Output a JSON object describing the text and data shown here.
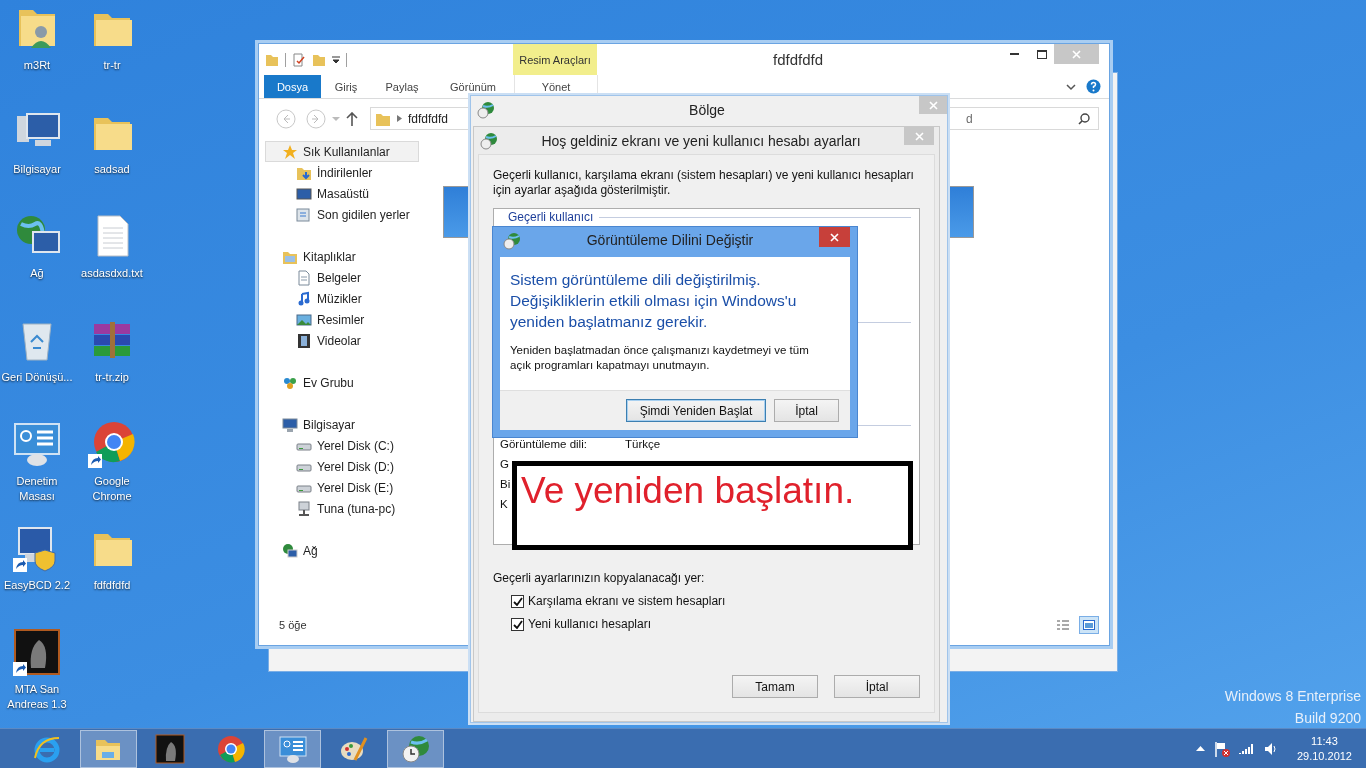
{
  "desktop_icons": [
    {
      "label": "m3Rt",
      "kind": "user-folder",
      "shortcut": false
    },
    {
      "label": "tr-tr",
      "kind": "folder",
      "shortcut": false
    },
    {
      "label": "Bilgisayar",
      "kind": "computer",
      "shortcut": false
    },
    {
      "label": "sadsad",
      "kind": "folder",
      "shortcut": false
    },
    {
      "label": "Ağ",
      "kind": "network",
      "shortcut": false
    },
    {
      "label": "asdasdxd.txt",
      "kind": "text",
      "shortcut": false
    },
    {
      "label": "Geri Dönüşü...",
      "kind": "recycle",
      "shortcut": false
    },
    {
      "label": "tr-tr.zip",
      "kind": "archive",
      "shortcut": false
    },
    {
      "label": "Denetim Masası",
      "kind": "control-panel",
      "shortcut": false
    },
    {
      "label": "Google Chrome",
      "kind": "chrome",
      "shortcut": true
    },
    {
      "label": "EasyBCD 2.2",
      "kind": "installer",
      "shortcut": true
    },
    {
      "label": "fdfdfdfd",
      "kind": "folder",
      "shortcut": false
    },
    {
      "label": "MTA San Andreas 1.3",
      "kind": "game",
      "shortcut": true
    }
  ],
  "watermark": [
    "Windows 8 Enterprise",
    "Build 9200"
  ],
  "explorer": {
    "contextual_tab": "Resim Araçları",
    "title": "fdfdfdfd",
    "ribbon_tabs": [
      {
        "label": "Dosya",
        "selected": true
      },
      {
        "label": "Giriş",
        "selected": false
      },
      {
        "label": "Paylaş",
        "selected": false
      },
      {
        "label": "Görünüm",
        "selected": false
      },
      {
        "label": "Yönet",
        "selected": false
      }
    ],
    "address": "fdfdfdfd",
    "search_placeholder": "d",
    "nav": [
      {
        "label": "Sık Kullanılanlar",
        "kind": "star",
        "selected": true,
        "children": [
          {
            "label": "İndirilenler",
            "kind": "download",
            "selected": false
          },
          {
            "label": "Masaüstü",
            "kind": "desktop",
            "selected": false
          },
          {
            "label": "Son gidilen yerler",
            "kind": "recent",
            "selected": false
          }
        ]
      },
      {
        "label": "Kitaplıklar",
        "kind": "library",
        "selected": false,
        "children": [
          {
            "label": "Belgeler",
            "kind": "documents",
            "selected": false
          },
          {
            "label": "Müzikler",
            "kind": "music",
            "selected": false
          },
          {
            "label": "Resimler",
            "kind": "pictures",
            "selected": false
          },
          {
            "label": "Videolar",
            "kind": "videos",
            "selected": false
          }
        ]
      },
      {
        "label": "Ev Grubu",
        "kind": "homegroup",
        "selected": false
      },
      {
        "label": "Bilgisayar",
        "kind": "computer",
        "selected": false,
        "children": [
          {
            "label": "Yerel Disk (C:)",
            "kind": "disk",
            "selected": false
          },
          {
            "label": "Yerel Disk (D:)",
            "kind": "disk",
            "selected": false
          },
          {
            "label": "Yerel Disk (E:)",
            "kind": "disk",
            "selected": false
          },
          {
            "label": "Tuna (tuna-pc)",
            "kind": "network-drive",
            "selected": false
          }
        ]
      },
      {
        "label": "Ağ",
        "kind": "network",
        "selected": false
      }
    ],
    "status": "5 öğe"
  },
  "region_dialog": {
    "title": "Bölge"
  },
  "welcome_dialog": {
    "title": "Hoş geldiniz ekranı ve yeni kullanıcı hesabı ayarları",
    "intro": "Geçerli kullanıcı, karşılama ekranı (sistem hesapları) ve yeni kullanıcı hesapları için ayarlar aşağıda gösterilmiştir.",
    "group_label": "Geçerli kullanıcı",
    "rows": [
      {
        "label": "Görüntüleme dili:",
        "value": "Türkçe"
      },
      {
        "label": "G"
      },
      {
        "label": "Bi"
      },
      {
        "label": "K"
      }
    ],
    "copy_label": "Geçerli ayarlarınızın kopyalanacağı yer:",
    "checkboxes": [
      {
        "label": "Karşılama ekranı ve sistem hesapları",
        "checked": true
      },
      {
        "label": "Yeni kullanıcı hesapları",
        "checked": true
      }
    ],
    "buttons": [
      "Tamam",
      "İptal"
    ]
  },
  "change_dialog": {
    "title": "Görüntüleme Dilini Değiştir",
    "headline": "Sistem görüntüleme dili değiştirilmiş. Değişikliklerin etkili olması için Windows'u yeniden başlatmanız gerekir.",
    "body": "Yeniden başlatmadan önce çalışmanızı kaydetmeyi ve tüm açık programları kapatmayı unutmayın.",
    "buttons": [
      {
        "label": "Şimdi Yeniden Başlat",
        "default": true
      },
      {
        "label": "İptal",
        "default": false
      }
    ]
  },
  "annotation": "Ve yeniden başlatın.",
  "taskbar": {
    "apps": [
      {
        "kind": "ie",
        "active": false
      },
      {
        "kind": "explorer",
        "active": true
      },
      {
        "kind": "game",
        "active": false
      },
      {
        "kind": "chrome",
        "active": false
      },
      {
        "kind": "control-panel",
        "active": true
      },
      {
        "kind": "paint",
        "active": false
      },
      {
        "kind": "region",
        "active": true
      }
    ],
    "time": "11:43",
    "date": "29.10.2012"
  }
}
